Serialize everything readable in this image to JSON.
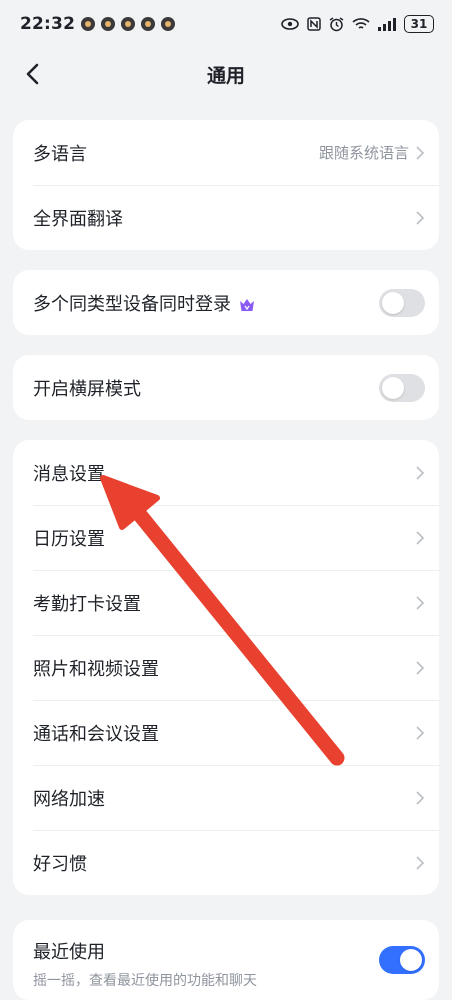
{
  "status_bar": {
    "time": "22:32",
    "battery": "31",
    "icons": [
      "eye-icon",
      "nfc-icon",
      "alarm-icon",
      "wifi-icon",
      "signal-icon"
    ]
  },
  "nav": {
    "title": "通用"
  },
  "group1": [
    {
      "label": "多语言",
      "value": "跟随系统语言"
    },
    {
      "label": "全界面翻译"
    }
  ],
  "group2": {
    "label": "多个同类型设备同时登录",
    "toggle": "off"
  },
  "group3": {
    "label": "开启横屏模式",
    "toggle": "off"
  },
  "group4": [
    {
      "label": "消息设置"
    },
    {
      "label": "日历设置"
    },
    {
      "label": "考勤打卡设置"
    },
    {
      "label": "照片和视频设置"
    },
    {
      "label": "通话和会议设置"
    },
    {
      "label": "网络加速"
    },
    {
      "label": "好习惯"
    }
  ],
  "group5": {
    "label": "最近使用",
    "sub": "摇一摇，查看最近使用的功能和聊天",
    "toggle": "on"
  },
  "colors": {
    "background": "#f2f3f5",
    "accent": "#3370ff",
    "annotation_arrow": "#e8412f",
    "premium_crown": "#8a5cf6"
  }
}
